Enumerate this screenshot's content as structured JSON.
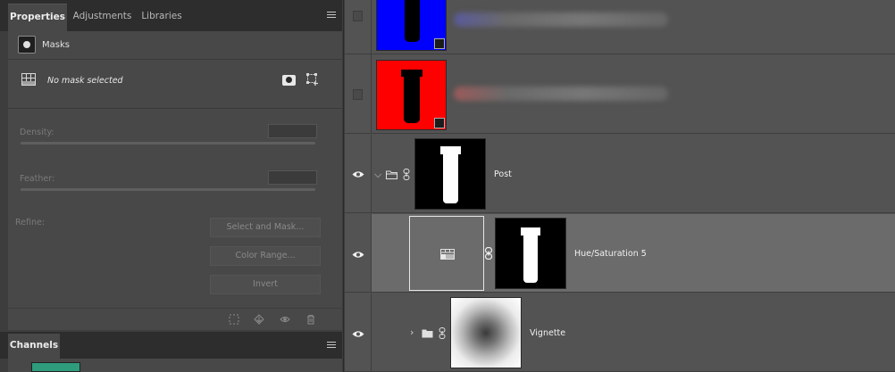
{
  "properties_panel": {
    "tabs": [
      {
        "label": "Properties",
        "active": true
      },
      {
        "label": "Adjustments",
        "active": false
      },
      {
        "label": "Libraries",
        "active": false
      }
    ],
    "section_title": "Masks",
    "mask_status": "No mask selected",
    "density_label": "Density:",
    "feather_label": "Feather:",
    "refine_label": "Refine:",
    "buttons": {
      "select_and_mask": "Select and Mask...",
      "color_range": "Color Range...",
      "invert": "Invert"
    },
    "footer_icons": [
      "load-selection-icon",
      "apply-mask-icon",
      "visibility-icon",
      "trash-icon"
    ]
  },
  "channels_panel": {
    "tab_label": "Channels"
  },
  "layers_panel": {
    "layers": [
      {
        "name": "",
        "visible": false,
        "thumbnail_color": "#0000ff",
        "name_blurred": true
      },
      {
        "name": "",
        "visible": false,
        "thumbnail_color": "#ff0000",
        "name_blurred": true
      },
      {
        "name": "Post",
        "visible": true,
        "type": "group",
        "expanded": true
      },
      {
        "name": "Hue/Saturation 5",
        "visible": true,
        "type": "adjustment",
        "selected": true
      },
      {
        "name": "Vignette",
        "visible": true,
        "type": "group",
        "expanded": false
      }
    ]
  },
  "colors": {
    "panel_bg": "#484848",
    "selected_row": "#6b6b6b",
    "blue_fill": "#0000ff",
    "red_fill": "#ff0000",
    "channels_thumb": "#2f9c7c"
  }
}
